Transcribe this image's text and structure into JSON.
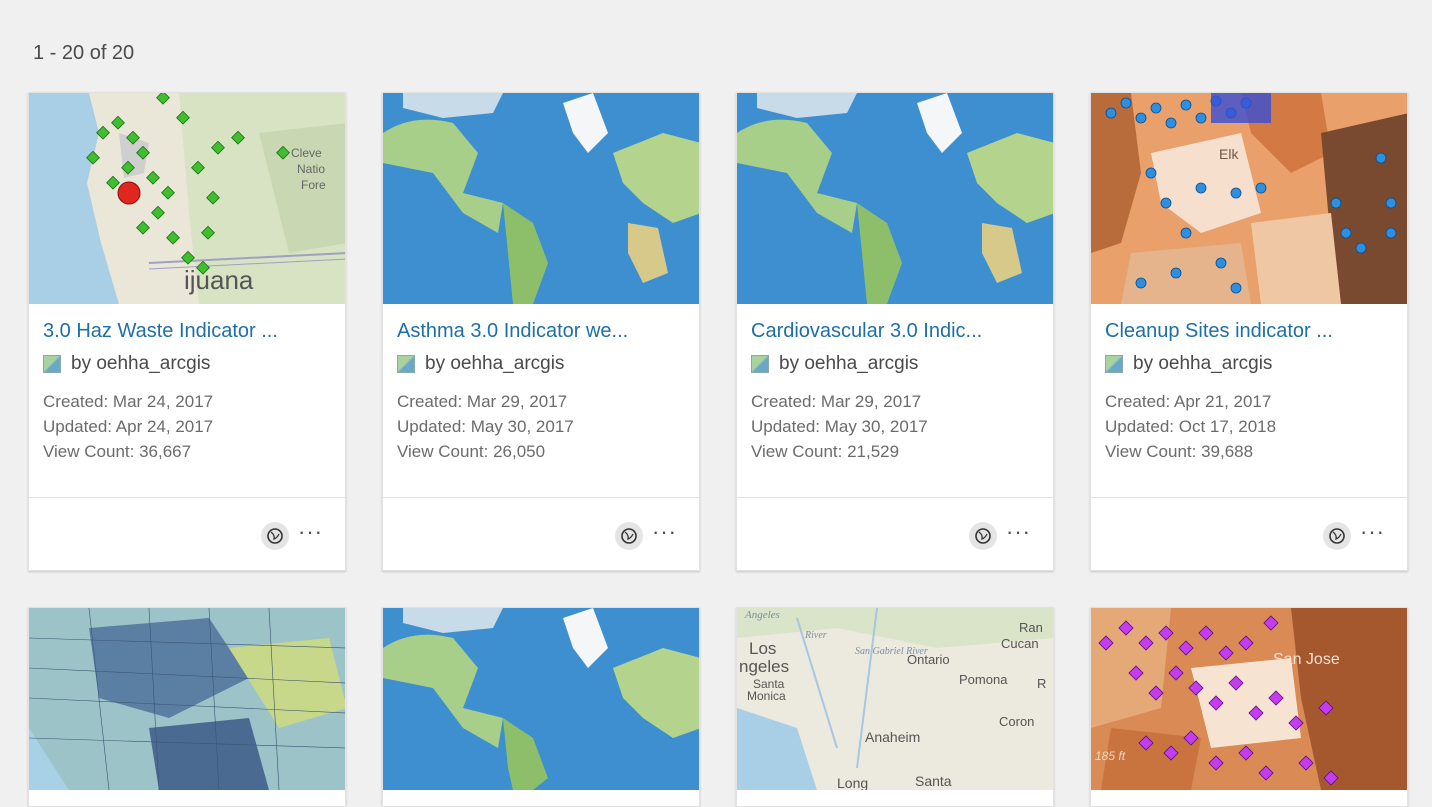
{
  "results": {
    "count_label": "1 - 20 of 20"
  },
  "cards": [
    {
      "title": "3.0 Haz Waste Indicator ...",
      "owner": "by oehha_arcgis",
      "created": "Created: Mar 24, 2017",
      "updated": "Updated: Apr 24, 2017",
      "views": "View Count: 36,667",
      "thumb_labels": [
        "Cleve",
        "Natio",
        "Fore",
        "ijuana"
      ]
    },
    {
      "title": "Asthma 3.0 Indicator we...",
      "owner": "by oehha_arcgis",
      "created": "Created: Mar 29, 2017",
      "updated": "Updated: May 30, 2017",
      "views": "View Count: 26,050"
    },
    {
      "title": "Cardiovascular 3.0 Indic...",
      "owner": "by oehha_arcgis",
      "created": "Created: Mar 29, 2017",
      "updated": "Updated: May 30, 2017",
      "views": "View Count: 21,529"
    },
    {
      "title": "Cleanup Sites indicator ...",
      "owner": "by oehha_arcgis",
      "created": "Created: Apr 21, 2017",
      "updated": "Updated: Oct 17, 2018",
      "views": "View Count: 39,688",
      "thumb_labels": [
        "Elk"
      ]
    }
  ],
  "row2_thumb_labels": {
    "basemap": [
      "Los",
      "ngeles",
      "Santa",
      "Monica",
      "Ontario",
      "Pomona",
      "R",
      "Ran",
      "Cucan",
      "Coron",
      "Anaheim",
      "Long",
      "Santa",
      "Angeles",
      "River",
      "San Gabriel River"
    ],
    "points": [
      "San Jose",
      "185 ft"
    ]
  },
  "icons": {
    "web_map": "web-map-icon",
    "more": "more-options-icon",
    "item_type": "map-thumbnail-icon"
  },
  "more_label": "···"
}
